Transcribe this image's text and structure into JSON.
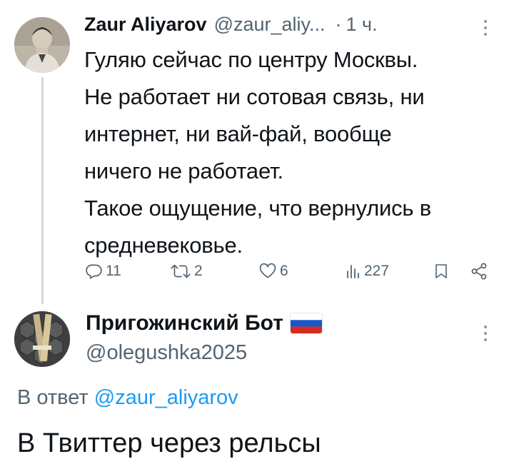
{
  "tweet": {
    "author_name": "Zaur Aliyarov",
    "handle": "@zaur_aliy...",
    "separator": "·",
    "time": "1 ч.",
    "body_lines": [
      "Гуляю сейчас по центру Москвы.",
      "Не работает ни сотовая связь, ни",
      "интернет, ни вай-фай, вообще",
      "ничего не работает.",
      "Такое ощущение, что вернулись в",
      "средневековье."
    ],
    "stats": {
      "replies": "11",
      "reposts": "2",
      "likes": "6",
      "views": "227"
    }
  },
  "reply": {
    "author_name": "Пригожинский Бот",
    "handle": "@olegushka2025",
    "reply_prefix": "В ответ",
    "reply_to": "@zaur_aliyarov",
    "body": "В Твиттер через рельсы"
  },
  "colors": {
    "text": "#0f1419",
    "secondary": "#536471",
    "link": "#1d9bf0",
    "thread_line": "#cfd9de"
  },
  "icons": [
    "more-icon",
    "reply-icon",
    "repost-icon",
    "like-icon",
    "views-icon",
    "bookmark-icon",
    "share-icon",
    "russia-flag-icon"
  ]
}
